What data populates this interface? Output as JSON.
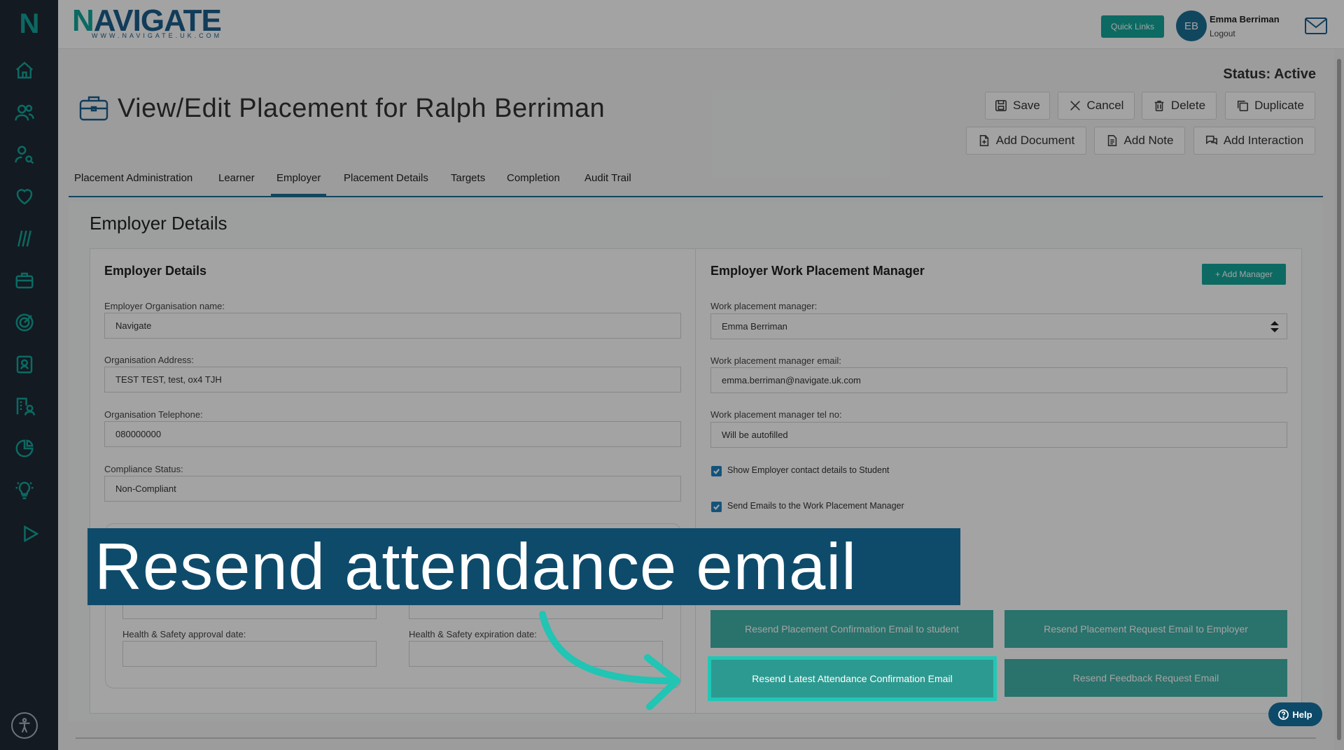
{
  "app": {
    "logo_text": "NAVIGATE",
    "logo_sub": "WWW.NAVIGATE.UK.COM"
  },
  "header": {
    "quick_links": "Quick Links",
    "avatar_initials": "EB",
    "user_name": "Emma Berriman",
    "logout": "Logout"
  },
  "sidebar": {
    "icons": [
      "home-icon",
      "users-icon",
      "user-search-icon",
      "heart-icon",
      "tally-icon",
      "briefcase-icon",
      "target-icon",
      "contact-card-icon",
      "building-user-icon",
      "pie-chart-icon",
      "lightbulb-icon",
      "play-icon"
    ]
  },
  "page": {
    "status": "Status: Active",
    "title": "View/Edit Placement for Ralph Berriman"
  },
  "actions": {
    "save": "Save",
    "cancel": "Cancel",
    "delete": "Delete",
    "duplicate": "Duplicate",
    "add_document": "Add Document",
    "add_note": "Add Note",
    "add_interaction": "Add Interaction"
  },
  "tabs": [
    "Placement Administration",
    "Learner",
    "Employer",
    "Placement Details",
    "Targets",
    "Completion",
    "Audit Trail"
  ],
  "active_tab": "Employer",
  "employer": {
    "section_title": "Employer Details",
    "card_title": "Employer Details",
    "org_name_label": "Employer Organisation name:",
    "org_name_value": "Navigate",
    "address_label": "Organisation Address:",
    "address_value": "TEST TEST, test, ox4 TJH",
    "telephone_label": "Organisation Telephone:",
    "telephone_value": "080000000",
    "compliance_label": "Compliance Status:",
    "compliance_value": "Non-Compliant",
    "hs_approval_label": "Health & Safety approval date:",
    "hs_expiration_label": "Health & Safety expiration date:"
  },
  "manager": {
    "title": "Employer Work Placement Manager",
    "add_manager": "+ Add Manager",
    "manager_label": "Work placement manager:",
    "manager_value": "Emma Berriman",
    "email_label": "Work placement manager email:",
    "email_value": "emma.berriman@navigate.uk.com",
    "tel_label": "Work placement manager tel no:",
    "tel_value": "Will be autofilled",
    "show_contact": "Show Employer contact details to Student",
    "send_emails": "Send Emails to the Work Placement Manager"
  },
  "resend": {
    "placement_confirmation": "Resend Placement Confirmation Email to student",
    "placement_request": "Resend Placement Request Email to Employer",
    "attendance_confirmation": "Resend Latest Attendance Confirmation Email",
    "feedback_request": "Resend Feedback Request Email"
  },
  "overlay": {
    "banner": "Resend attendance email",
    "help": "Help"
  },
  "colors": {
    "sidebar_bg": "#1e2a35",
    "accent_teal": "#13a79c",
    "brand_blue": "#1b5f8e",
    "banner_bg": "#0e4b6b",
    "highlight": "#21c7b6"
  }
}
